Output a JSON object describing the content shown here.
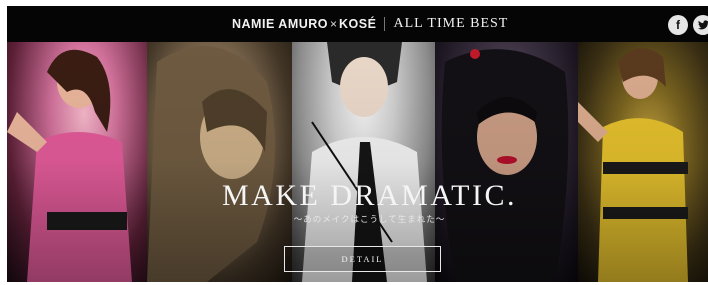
{
  "header": {
    "brand": "NAMIE AMURO",
    "cross": "×",
    "partner": "KOSÉ",
    "subtitle": "ALL TIME BEST"
  },
  "social": {
    "facebook_glyph": "f",
    "twitter_glyph": "🐦",
    "facebook_icon": "facebook-icon",
    "twitter_icon": "twitter-icon"
  },
  "hero": {
    "headline": "MAKE DRAMATIC.",
    "subline": "～あのメイクはこうして生まれた～",
    "button_label": "DETAIL"
  },
  "colors": {
    "topbar": "#050505",
    "text": "#f5f5f5",
    "panel1": "#d0709a",
    "panel2": "#8b7558",
    "panel3": "#cfcfcf",
    "panel4": "#3a3040",
    "panel5": "#c9a640"
  }
}
